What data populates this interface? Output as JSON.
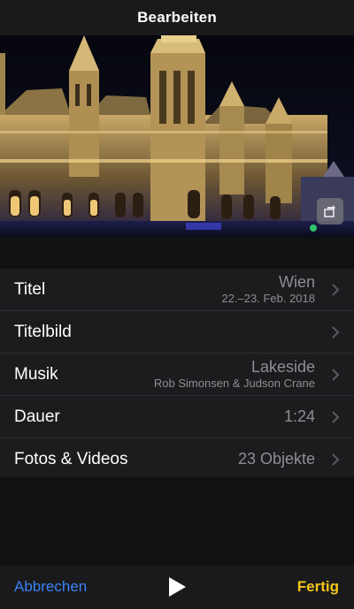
{
  "header": {
    "title": "Bearbeiten"
  },
  "rows": [
    {
      "label": "Titel",
      "value": "Wien",
      "subvalue": "22.–23. Feb. 2018"
    },
    {
      "label": "Titelbild",
      "value": "",
      "subvalue": ""
    },
    {
      "label": "Musik",
      "value": "Lakeside",
      "subvalue": "Rob Simonsen & Judson Crane"
    },
    {
      "label": "Dauer",
      "value": "1:24",
      "subvalue": ""
    },
    {
      "label": "Fotos & Videos",
      "value": "23 Objekte",
      "subvalue": ""
    }
  ],
  "footer": {
    "cancel_label": "Abbrechen",
    "done_label": "Fertig"
  },
  "colors": {
    "cancel": "#3b82f6",
    "done": "#f5c518",
    "secondary_text": "#8e8e93"
  },
  "icons": {
    "chevron": "chevron-right-icon",
    "play": "play-icon",
    "rotate": "rotate-icon"
  }
}
